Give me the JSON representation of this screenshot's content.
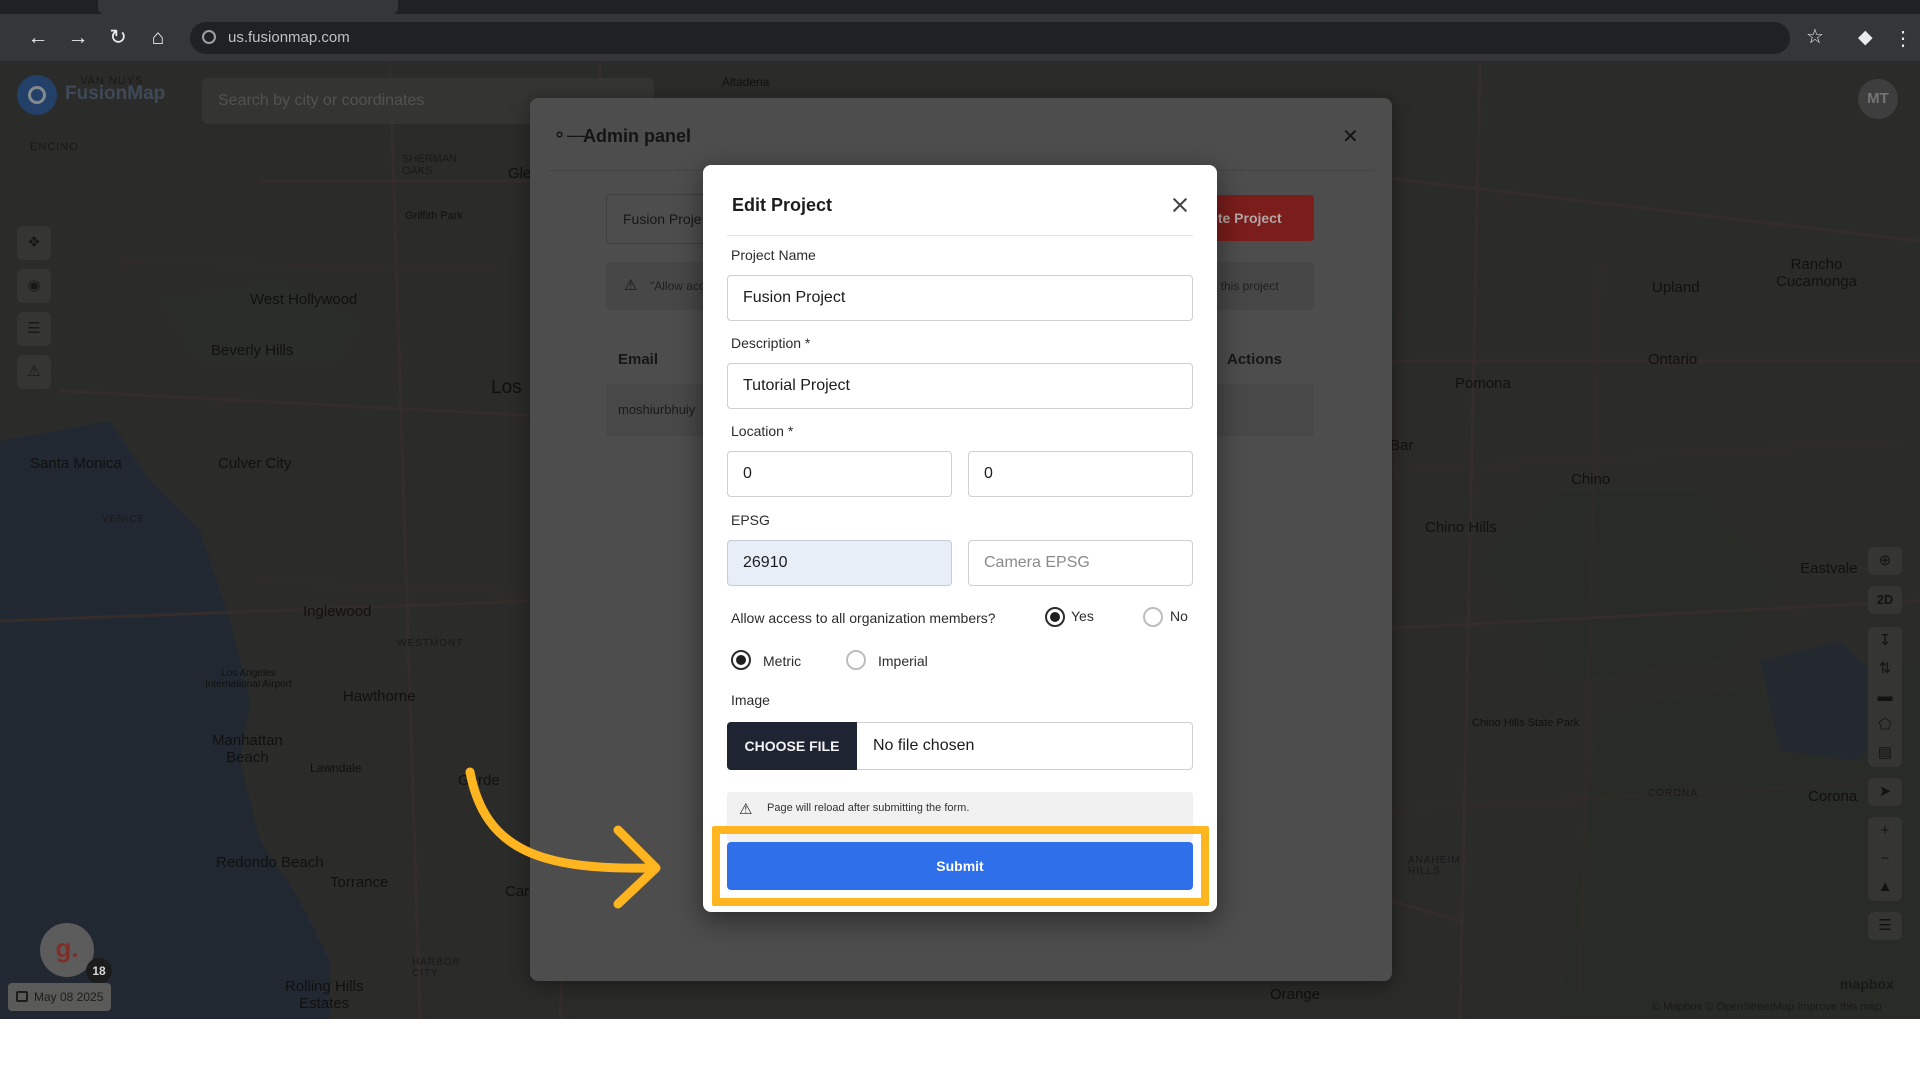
{
  "browser": {
    "url": "us.fusionmap.com",
    "icons": [
      "back-icon",
      "forward-icon",
      "reload-icon",
      "home-icon",
      "bookmark-star-icon",
      "extensions-icon",
      "menu-icon"
    ]
  },
  "map": {
    "logo_text": "FusionMap",
    "search_placeholder": "Search by city or coordinates",
    "user_initials": "MT",
    "places": {
      "alta": "Altadena",
      "griffith": "Griffith Park",
      "west_hollywood": "West Hollywood",
      "beverly_hills": "Beverly Hills",
      "los": "Los",
      "santa_monica": "Santa Monica",
      "culver_city": "Culver City",
      "inglewood": "Inglewood",
      "hawthorne": "Hawthorne",
      "manhattan_beach": "Manhattan\nBeach",
      "redondo_beach": "Redondo Beach",
      "torrance": "Torrance",
      "rolling_hills": "Rolling Hills\nEstates",
      "rancho": "Rancho\nCucamonga",
      "upland": "Upland",
      "ontario": "Ontario",
      "pomona": "Pomona",
      "chino": "Chino",
      "chino_hills": "Chino Hills",
      "eastvale": "Eastvale",
      "corona": "Corona",
      "orange": "Orange",
      "van_nuys": "VAN NUYS",
      "encino": "ENCINO",
      "sherman_oaks": "SHERMAN\nOAKS",
      "venice": "VENICE",
      "westmont": "WESTMONT",
      "lawndale": "Lawndale",
      "garde": "Garde",
      "car": "Car",
      "bar": "Bar",
      "gle": "Gle",
      "lax": "Los Angeles\nInternational Airport",
      "chino_hills_park": "Chino Hills State Park",
      "corona_label": "CORONA",
      "anaheim": "ANAHEIM\nHILLS",
      "harbor": "HARBOR\nCITY"
    },
    "avatar_letter": "g.",
    "badge_count": "18",
    "date": "May 08 2025",
    "attribution": "© Mapbox © OpenStreetMap  Improve this map",
    "mapbox": "mapbox",
    "view_mode": "2D"
  },
  "admin_panel": {
    "title": "Admin panel",
    "project_select_value": "Fusion Proje",
    "delete_label": "elete Project",
    "alert_left": "\"Allow acc",
    "alert_right": "ss to this project",
    "col_email": "Email",
    "col_actions": "Actions",
    "row_email": "moshiurbhuiy"
  },
  "dialog": {
    "title": "Edit Project",
    "project_name_label": "Project Name",
    "project_name_value": "Fusion Project",
    "description_label": "Description *",
    "description_value": "Tutorial Project",
    "location_label": "Location *",
    "location_x": "0",
    "location_y": "0",
    "epsg_label": "EPSG",
    "epsg_value": "26910",
    "camera_epsg_placeholder": "Camera EPSG",
    "allow_access_label": "Allow access to all organization members?",
    "yes_label": "Yes",
    "no_label": "No",
    "allow_access_selected": "Yes",
    "metric_label": "Metric",
    "imperial_label": "Imperial",
    "units_selected": "Metric",
    "image_label": "Image",
    "choose_file_label": "CHOOSE FILE",
    "file_status": "No file chosen",
    "alert_text": "Page will reload after submitting the form.",
    "submit_label": "Submit"
  },
  "colors": {
    "primary": "#2f6fe9",
    "highlight": "#ffb51f",
    "delete": "#d32f2f",
    "choose_file_bg": "#1f2433"
  }
}
